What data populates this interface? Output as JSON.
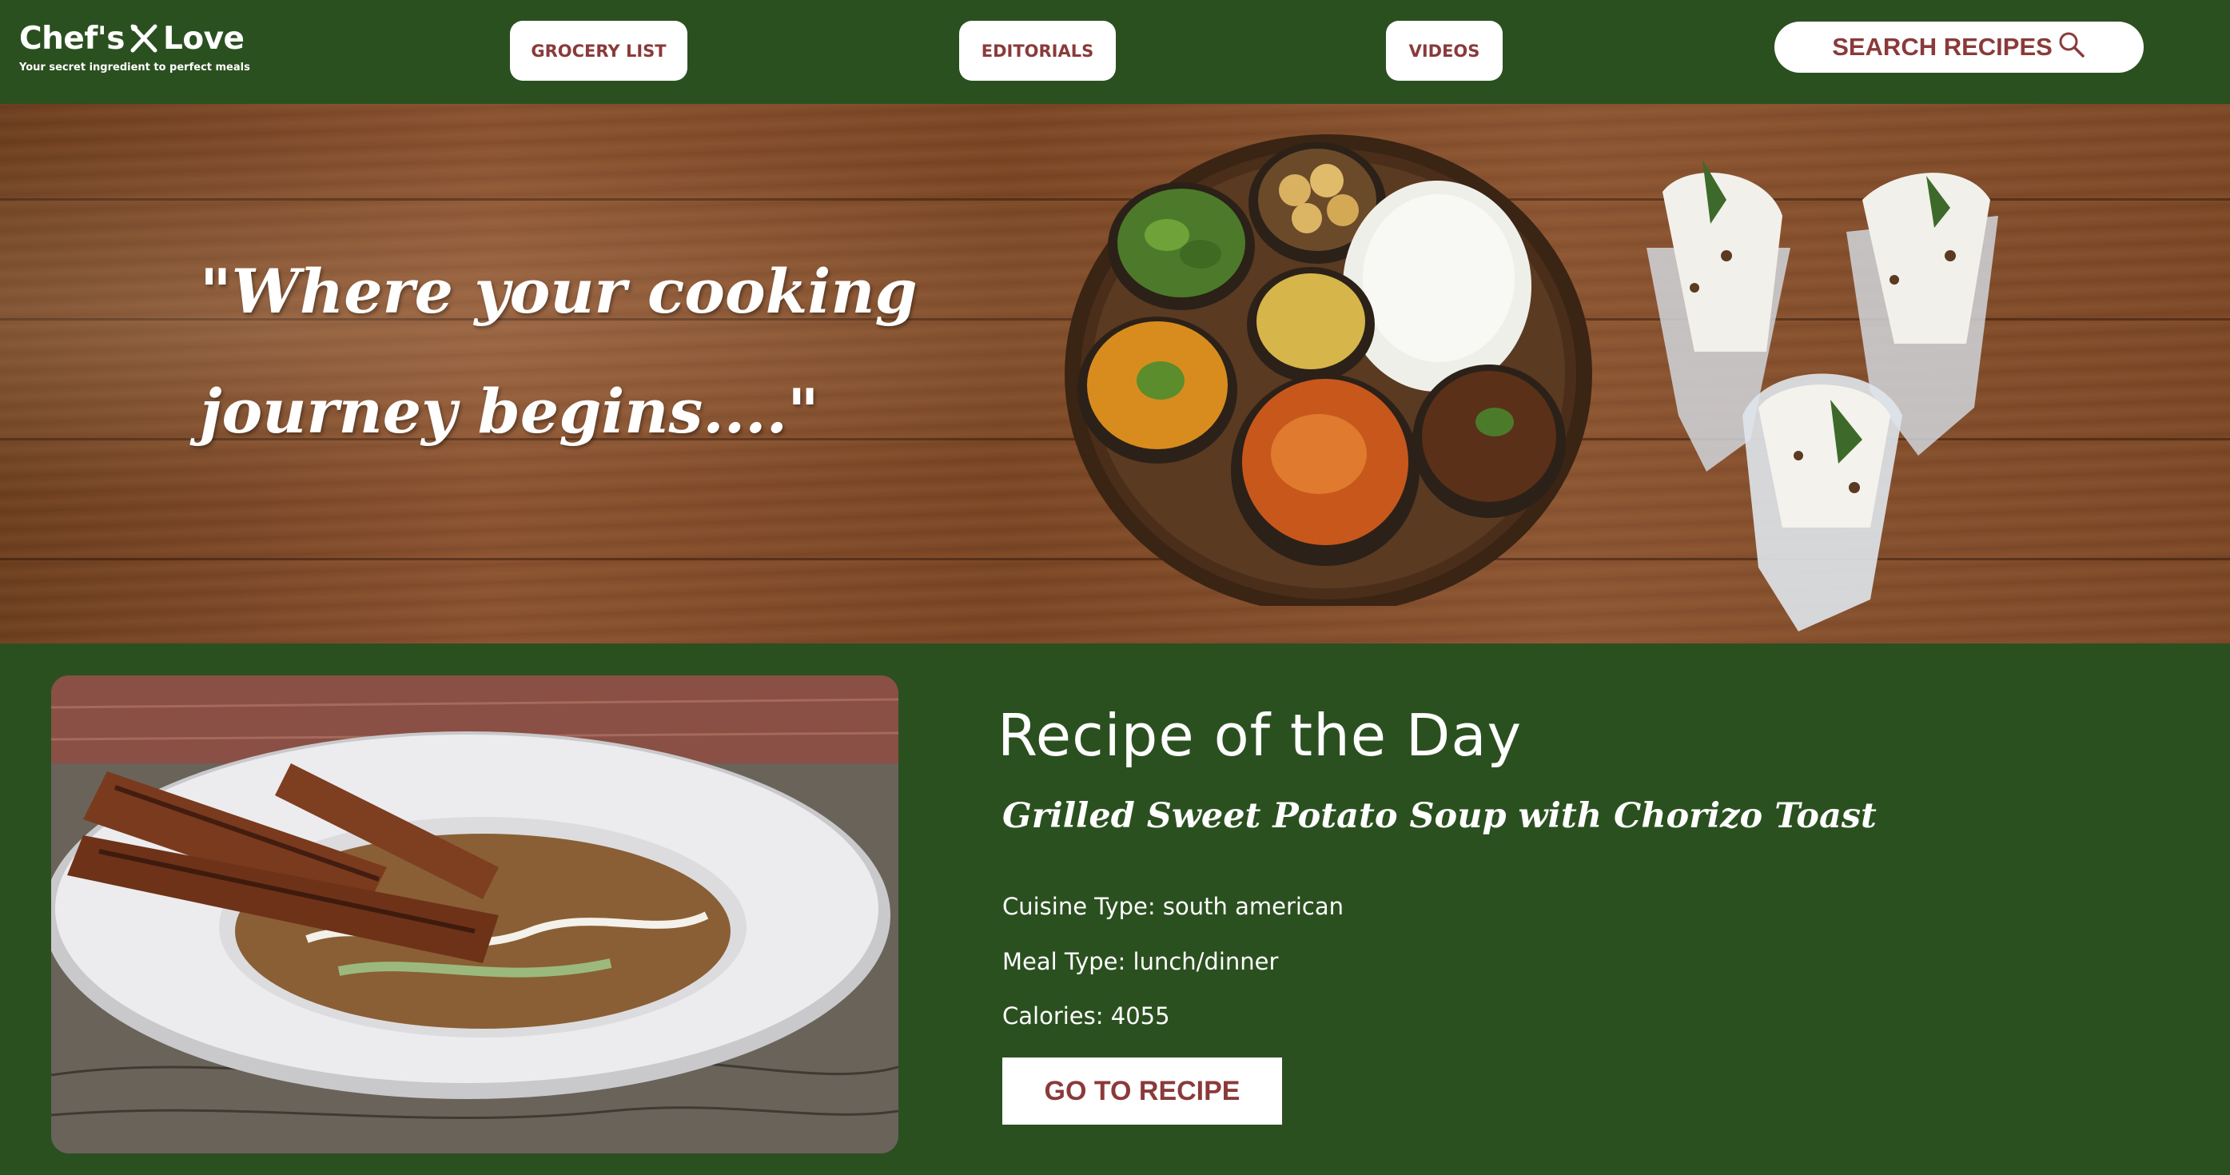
{
  "brand": {
    "name_left": "Chef's",
    "name_right": "Love",
    "tagline": "Your secret ingredient to perfect meals",
    "logo_icon": "crossed-fork-knife-icon"
  },
  "nav": {
    "grocery": "GROCERY LIST",
    "editorials": "EDITORIALS",
    "videos": "VIDEOS",
    "search": "SEARCH RECIPES",
    "search_icon": "search-icon"
  },
  "hero": {
    "quote_line1": "\"Where your cooking",
    "quote_line2": "journey begins....\""
  },
  "recipe_of_day": {
    "heading": "Recipe of the Day",
    "name": "Grilled Sweet Potato Soup with Chorizo Toast",
    "cuisine": "Cuisine Type: south american",
    "meal": "Meal Type: lunch/dinner",
    "calories": "Calories: 4055",
    "button": "GO TO RECIPE"
  },
  "colors": {
    "header_green": "#2b5020",
    "button_text": "#8a3a3a",
    "white": "#ffffff"
  }
}
